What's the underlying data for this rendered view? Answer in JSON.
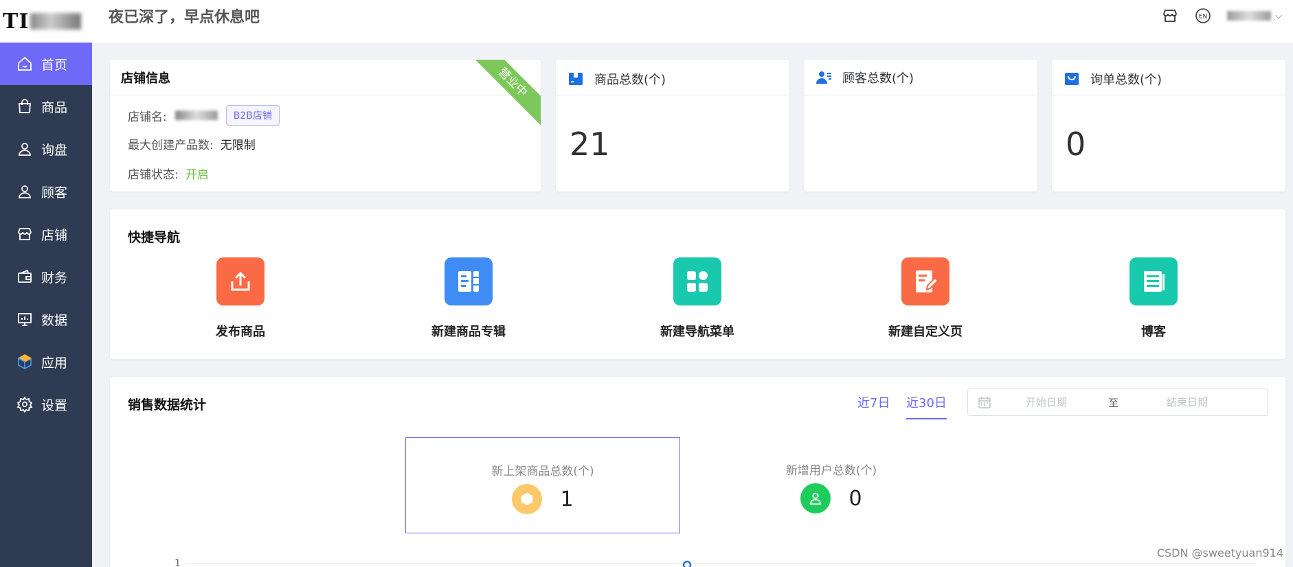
{
  "app": {
    "logo_text": "TI"
  },
  "header": {
    "greeting": "夜已深了，早点休息吧",
    "lang_icon": "EN"
  },
  "sidebar": {
    "items": [
      {
        "label": "首页",
        "icon": "home-icon",
        "active": true
      },
      {
        "label": "商品",
        "icon": "shopping-bag-icon"
      },
      {
        "label": "询盘",
        "icon": "user-icon"
      },
      {
        "label": "顾客",
        "icon": "user-icon"
      },
      {
        "label": "店铺",
        "icon": "store-icon"
      },
      {
        "label": "财务",
        "icon": "wallet-icon"
      },
      {
        "label": "数据",
        "icon": "chart-icon"
      },
      {
        "label": "应用",
        "icon": "box-icon"
      },
      {
        "label": "设置",
        "icon": "gear-icon"
      }
    ]
  },
  "store_info": {
    "title": "店铺信息",
    "ribbon": "营业中",
    "name_label": "店铺名:",
    "tag": "B2B店铺",
    "max_products_label": "最大创建产品数:",
    "max_products_value": "无限制",
    "status_label": "店铺状态:",
    "status_value": "开启",
    "status_color": "#67c23a"
  },
  "stats": {
    "products": {
      "title": "商品总数(个)",
      "value": "21"
    },
    "customers": {
      "title": "顾客总数(个)",
      "value": ""
    },
    "inquiries": {
      "title": "询单总数(个)",
      "value": "0"
    }
  },
  "quick_nav": {
    "title": "快捷导航",
    "items": [
      {
        "label": "发布商品",
        "color": "#f96a45"
      },
      {
        "label": "新建商品专辑",
        "color": "#3f8cf4"
      },
      {
        "label": "新建导航菜单",
        "color": "#19c9ad"
      },
      {
        "label": "新建自定义页",
        "color": "#f96a45"
      },
      {
        "label": "博客",
        "color": "#19c9ad"
      }
    ]
  },
  "sales": {
    "title": "销售数据统计",
    "tabs": [
      {
        "label": "近7日",
        "active": false
      },
      {
        "label": "近30日",
        "active": true
      }
    ],
    "start_placeholder": "开始日期",
    "range_separator": "至",
    "end_placeholder": "结束日期",
    "new_products": {
      "label": "新上架商品总数(个)",
      "value": "1",
      "color": "#fcc96a"
    },
    "new_users": {
      "label": "新增用户总数(个)",
      "value": "0",
      "color": "#1ccc5c"
    },
    "axis_tick": "1"
  },
  "accent_color": "#6e6af7",
  "watermark": "CSDN @sweetyuan914"
}
